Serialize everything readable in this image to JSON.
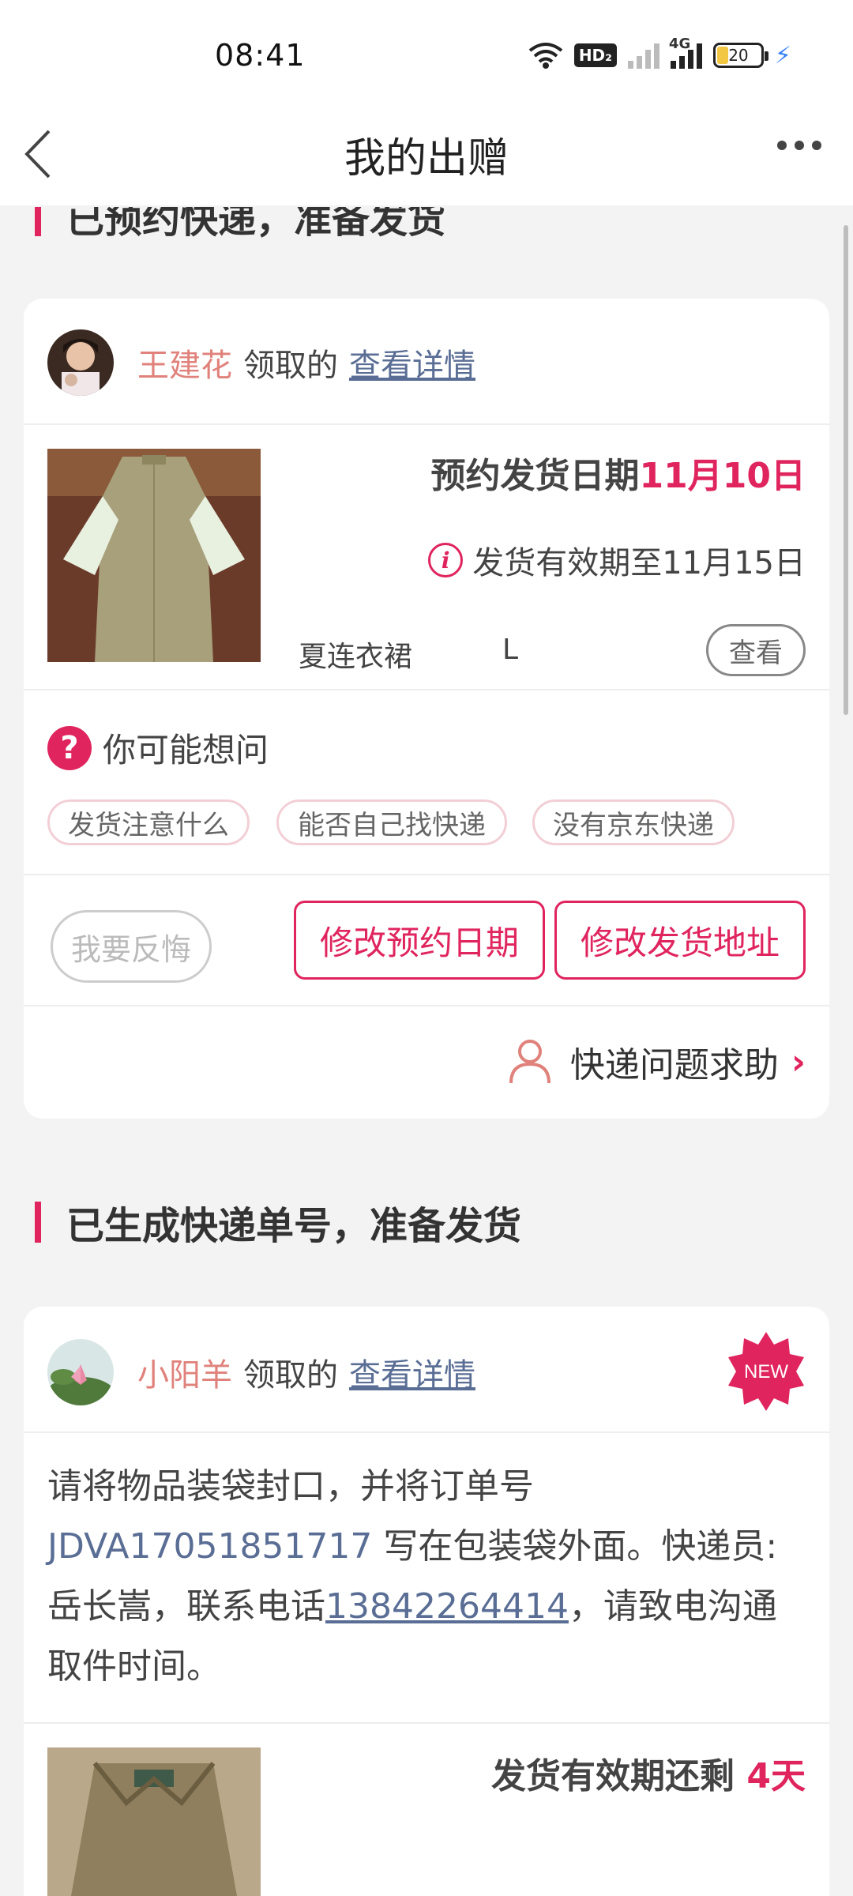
{
  "status_bar": {
    "time": "08:41",
    "hd_label": "HD₂",
    "network_label": "4G",
    "battery_level": "20"
  },
  "nav": {
    "title": "我的出赠"
  },
  "sections": [
    {
      "title": "已预约快递，准备发货"
    },
    {
      "title": "已生成快递单号，准备发货"
    }
  ],
  "card1": {
    "receiver_name": "王建花",
    "received_text": "领取的",
    "detail_link": "查看详情",
    "booking_label": "预约发货日期",
    "booking_date": "11月10日",
    "valid_until": "发货有效期至11月15日",
    "item_name": "夏连衣裙",
    "item_size": "L",
    "view_label": "查看",
    "faq_title": "你可能想问",
    "faq_chips": [
      "发货注意什么",
      "能否自己找快递",
      "没有京东快递"
    ],
    "regret_label": "我要反悔",
    "change_date_label": "修改预约日期",
    "change_address_label": "修改发货地址",
    "help_label": "快递问题求助"
  },
  "card2": {
    "receiver_name": "小阳羊",
    "received_text": "领取的",
    "detail_link": "查看详情",
    "new_badge": "NEW",
    "instruction_part1": "请将物品装袋封口，并将订单号 ",
    "order_number": "JDVA17051851717",
    "instruction_part2": " 写在包装袋外面。快递员:岳长嵩，联系电话",
    "phone": "13842264414",
    "instruction_part3": "，请致电沟通取件时间。",
    "remain_label": "发货有效期还剩 ",
    "remain_days": "4天"
  },
  "colors": {
    "accent": "#e0245e",
    "link": "#5a6e95",
    "name": "#e0827b"
  }
}
